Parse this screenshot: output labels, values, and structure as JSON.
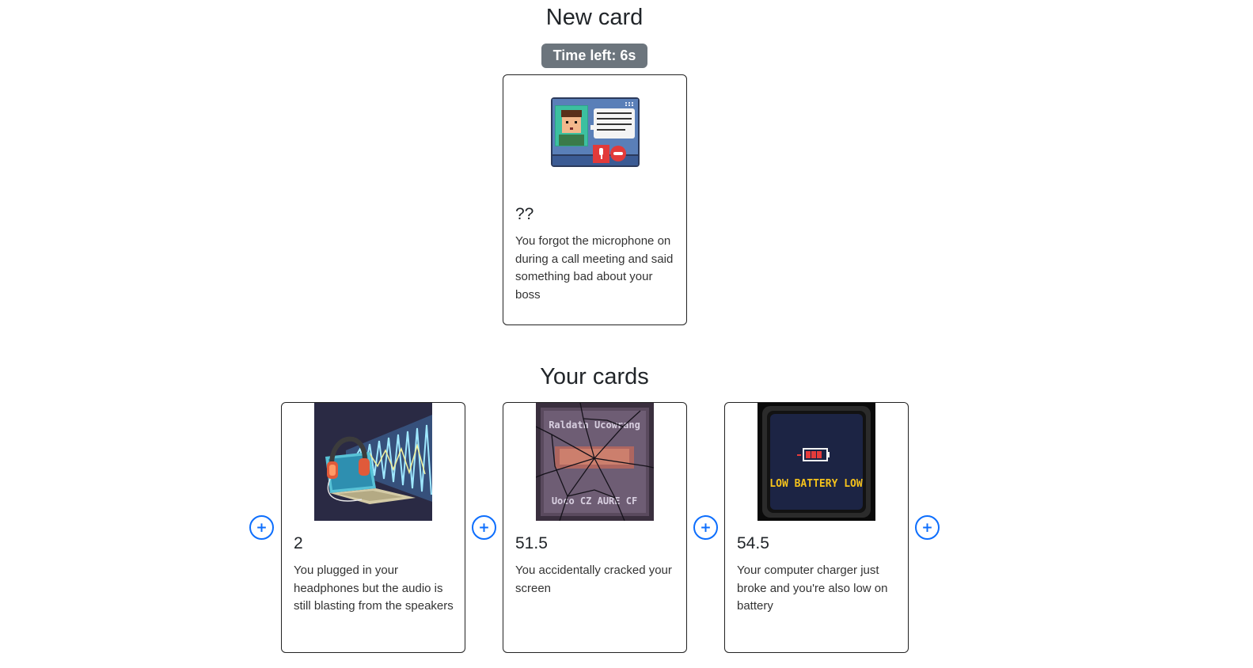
{
  "new_section": {
    "title": "New card",
    "timer": "Time left: 6s",
    "card": {
      "value": "??",
      "description": "You forgot the microphone on during a call meeting and said something bad about your boss",
      "icon": "video-call-icon"
    }
  },
  "hand_section": {
    "title": "Your cards",
    "add_label": "+",
    "cards": [
      {
        "value": "2",
        "description": "You plugged in your headphones but the audio is still blasting from the speakers",
        "icon": "laptop-headphones-icon"
      },
      {
        "value": "51.5",
        "description": "You accidentally cracked your screen",
        "icon": "cracked-screen-icon",
        "image_text_top": "Raldatn Ucowrang",
        "image_text_bottom": "Uoco CZ AURE CF"
      },
      {
        "value": "54.5",
        "description": "Your computer charger just broke and you're also low on battery",
        "icon": "low-battery-icon",
        "image_text": "LOW BATTERY LOW"
      }
    ]
  },
  "colors": {
    "timer_badge": "#6c757d",
    "add_button": "#0d6efd",
    "card_border": "#222222"
  }
}
